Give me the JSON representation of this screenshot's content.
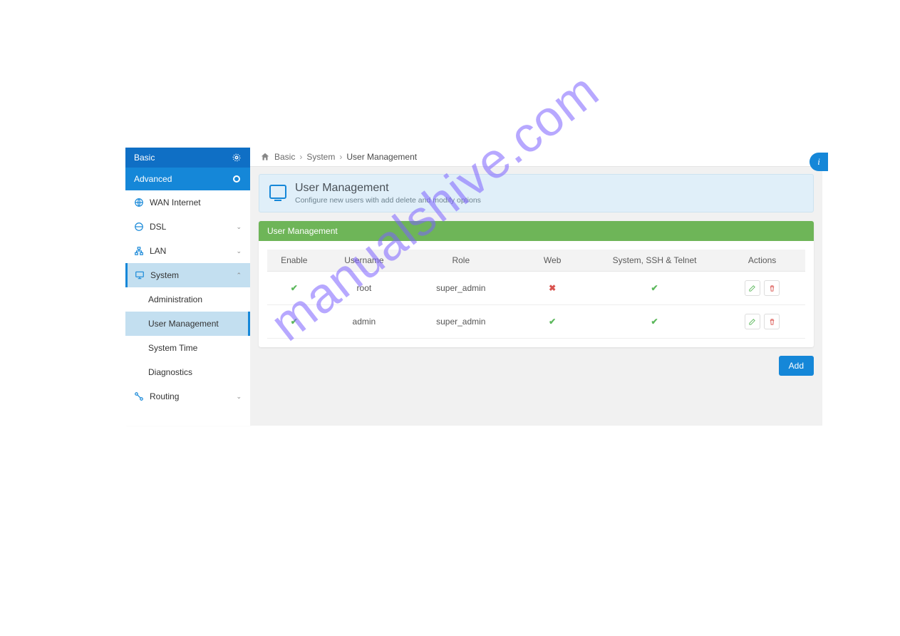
{
  "sidebar": {
    "basic_label": "Basic",
    "advanced_label": "Advanced",
    "items": {
      "wan": "WAN Internet",
      "dsl": "DSL",
      "lan": "LAN",
      "system": "System",
      "routing": "Routing"
    },
    "system_sub": {
      "administration": "Administration",
      "user_management": "User Management",
      "system_time": "System Time",
      "diagnostics": "Diagnostics"
    }
  },
  "breadcrumb": {
    "level1": "Basic",
    "level2": "System",
    "level3": "User Management",
    "sep": "›"
  },
  "header": {
    "title": "User Management",
    "subtitle": "Configure new users with add delete and modify options"
  },
  "panel": {
    "title": "User Management"
  },
  "table": {
    "columns": {
      "enable": "Enable",
      "username": "Username",
      "role": "Role",
      "web": "Web",
      "ssh": "System, SSH & Telnet",
      "actions": "Actions"
    },
    "rows": [
      {
        "enable": "✔",
        "username": "root",
        "role": "super_admin",
        "web": "✖",
        "ssh": "✔"
      },
      {
        "enable": "✔",
        "username": "admin",
        "role": "super_admin",
        "web": "✔",
        "ssh": "✔"
      }
    ]
  },
  "buttons": {
    "add": "Add"
  },
  "info_icon": "i",
  "watermark": "manualshive.com",
  "colors": {
    "primary": "#1587d8",
    "panel_header": "#6eb558",
    "header_bg": "#e0eff9",
    "success": "#5cb85c",
    "danger": "#d9534f"
  }
}
